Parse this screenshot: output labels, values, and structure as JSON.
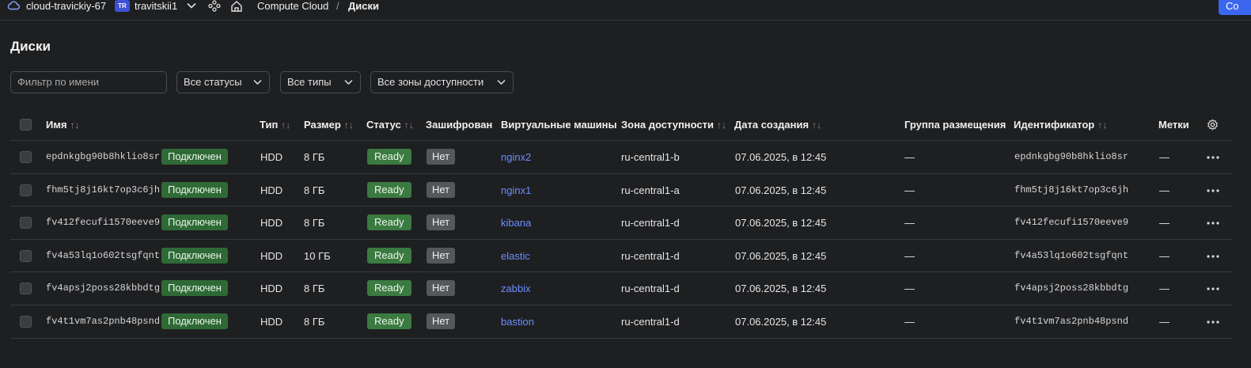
{
  "topbar": {
    "cloud": "cloud-travickiy-67",
    "badge": "TR",
    "account": "travitskii1",
    "service": "Compute Cloud",
    "separator": "/",
    "current": "Диски",
    "cta": "Co"
  },
  "page_title": "Диски",
  "filters": {
    "name_placeholder": "Фильтр по имени",
    "status": "Все статусы",
    "type": "Все типы",
    "zone": "Все зоны доступности"
  },
  "columns": {
    "name": "Имя",
    "type": "Тип",
    "size": "Размер",
    "status": "Статус",
    "encrypted": "Зашифрован",
    "vms": "Виртуальные машины",
    "zone": "Зона доступности",
    "created": "Дата создания",
    "group": "Группа размещения",
    "id": "Идентификатор",
    "labels": "Метки"
  },
  "sort_glyph": "↑↓",
  "rows": [
    {
      "name": "epdnkgbg90b8hklio8sr",
      "attach": "Подключен",
      "type": "HDD",
      "size": "8 ГБ",
      "status": "Ready",
      "encrypted": "Нет",
      "vm": "nginx2",
      "zone": "ru-central1-b",
      "created": "07.06.2025, в 12:45",
      "group": "—",
      "id": "epdnkgbg90b8hklio8sr",
      "labels": "—"
    },
    {
      "name": "fhm5tj8j16kt7op3c6jh",
      "attach": "Подключен",
      "type": "HDD",
      "size": "8 ГБ",
      "status": "Ready",
      "encrypted": "Нет",
      "vm": "nginx1",
      "zone": "ru-central1-a",
      "created": "07.06.2025, в 12:45",
      "group": "—",
      "id": "fhm5tj8j16kt7op3c6jh",
      "labels": "—"
    },
    {
      "name": "fv412fecufi1570eeve9",
      "attach": "Подключен",
      "type": "HDD",
      "size": "8 ГБ",
      "status": "Ready",
      "encrypted": "Нет",
      "vm": "kibana",
      "zone": "ru-central1-d",
      "created": "07.06.2025, в 12:45",
      "group": "—",
      "id": "fv412fecufi1570eeve9",
      "labels": "—"
    },
    {
      "name": "fv4a53lq1o602tsgfqnt",
      "attach": "Подключен",
      "type": "HDD",
      "size": "10 ГБ",
      "status": "Ready",
      "encrypted": "Нет",
      "vm": "elastic",
      "zone": "ru-central1-d",
      "created": "07.06.2025, в 12:45",
      "group": "—",
      "id": "fv4a53lq1o602tsgfqnt",
      "labels": "—"
    },
    {
      "name": "fv4apsj2poss28kbbdtg",
      "attach": "Подключен",
      "type": "HDD",
      "size": "8 ГБ",
      "status": "Ready",
      "encrypted": "Нет",
      "vm": "zabbix",
      "zone": "ru-central1-d",
      "created": "07.06.2025, в 12:45",
      "group": "—",
      "id": "fv4apsj2poss28kbbdtg",
      "labels": "—"
    },
    {
      "name": "fv4t1vm7as2pnb48psnd",
      "attach": "Подключен",
      "type": "HDD",
      "size": "8 ГБ",
      "status": "Ready",
      "encrypted": "Нет",
      "vm": "bastion",
      "zone": "ru-central1-d",
      "created": "07.06.2025, в 12:45",
      "group": "—",
      "id": "fv4t1vm7as2pnb48psnd",
      "labels": "—"
    }
  ]
}
